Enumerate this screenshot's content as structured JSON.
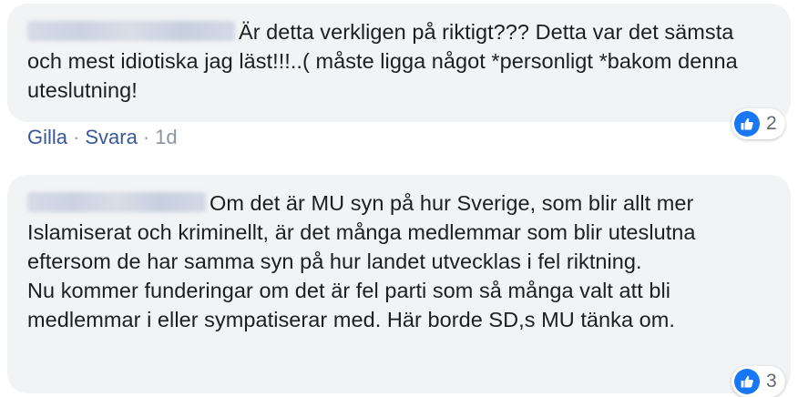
{
  "comments": [
    {
      "text": "Är detta verkligen på riktigt??? Detta var det sämsta och mest idiotiska jag läst!!!..( måste ligga något *personligt *bakom denna uteslutning!",
      "reaction_icon": "thumbs-up-icon",
      "reaction_count": "2",
      "actions": {
        "like": "Gilla",
        "reply": "Svara",
        "separator": "·",
        "time": "1d"
      }
    },
    {
      "text": "Om det är MU syn på hur Sverige, som blir allt mer Islamiserat och kriminellt, är det många medlemmar som blir uteslutna eftersom de har samma syn på hur landet utvecklas i fel riktning.",
      "text2": "Nu kommer funderingar om det är fel parti som så många valt att bli medlemmar i eller sympatiserar med. Här borde SD,s MU tänka om.",
      "reaction_icon": "thumbs-up-icon",
      "reaction_count": "3"
    }
  ],
  "colors": {
    "bubble": "#f2f3f5",
    "link": "#385898",
    "like": "#1877f2"
  }
}
